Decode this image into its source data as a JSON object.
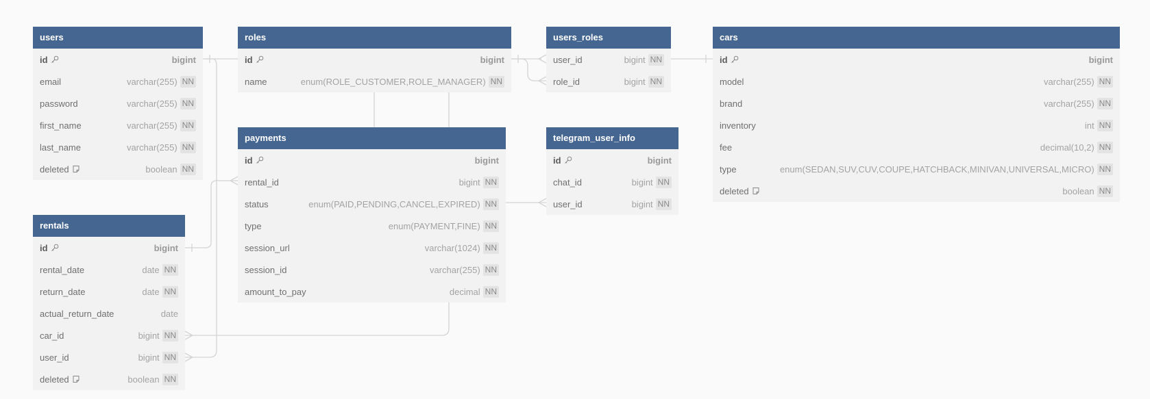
{
  "colors": {
    "header_bg": "#456690",
    "body_bg": "#f2f2f2",
    "canvas_bg": "#fafafa",
    "link": "#d4d4d4"
  },
  "tables": [
    {
      "name": "users",
      "fields": [
        {
          "name": "id",
          "type": "bigint",
          "pk": true,
          "nn": false
        },
        {
          "name": "email",
          "type": "varchar(255)",
          "nn": true
        },
        {
          "name": "password",
          "type": "varchar(255)",
          "nn": true
        },
        {
          "name": "first_name",
          "type": "varchar(255)",
          "nn": true
        },
        {
          "name": "last_name",
          "type": "varchar(255)",
          "nn": true
        },
        {
          "name": "deleted",
          "type": "boolean",
          "nn": true,
          "note": true
        }
      ]
    },
    {
      "name": "roles",
      "fields": [
        {
          "name": "id",
          "type": "bigint",
          "pk": true,
          "nn": false
        },
        {
          "name": "name",
          "type": "enum(ROLE_CUSTOMER,ROLE_MANAGER)",
          "nn": true
        }
      ]
    },
    {
      "name": "users_roles",
      "fields": [
        {
          "name": "user_id",
          "type": "bigint",
          "nn": true
        },
        {
          "name": "role_id",
          "type": "bigint",
          "nn": true
        }
      ]
    },
    {
      "name": "cars",
      "fields": [
        {
          "name": "id",
          "type": "bigint",
          "pk": true,
          "nn": false
        },
        {
          "name": "model",
          "type": "varchar(255)",
          "nn": true
        },
        {
          "name": "brand",
          "type": "varchar(255)",
          "nn": true
        },
        {
          "name": "inventory",
          "type": "int",
          "nn": true
        },
        {
          "name": "fee",
          "type": "decimal(10,2)",
          "nn": true
        },
        {
          "name": "type",
          "type": "enum(SEDAN,SUV,CUV,COUPE,HATCHBACK,MINIVAN,UNIVERSAL,MICRO)",
          "nn": true
        },
        {
          "name": "deleted",
          "type": "boolean",
          "nn": true,
          "note": true
        }
      ]
    },
    {
      "name": "payments",
      "fields": [
        {
          "name": "id",
          "type": "bigint",
          "pk": true,
          "nn": false
        },
        {
          "name": "rental_id",
          "type": "bigint",
          "nn": true
        },
        {
          "name": "status",
          "type": "enum(PAID,PENDING,CANCEL,EXPIRED)",
          "nn": true
        },
        {
          "name": "type",
          "type": "enum(PAYMENT,FINE)",
          "nn": true
        },
        {
          "name": "session_url",
          "type": "varchar(1024)",
          "nn": true
        },
        {
          "name": "session_id",
          "type": "varchar(255)",
          "nn": true
        },
        {
          "name": "amount_to_pay",
          "type": "decimal",
          "nn": true
        }
      ]
    },
    {
      "name": "telegram_user_info",
      "fields": [
        {
          "name": "id",
          "type": "bigint",
          "pk": true,
          "nn": false
        },
        {
          "name": "chat_id",
          "type": "bigint",
          "nn": true
        },
        {
          "name": "user_id",
          "type": "bigint",
          "nn": true
        }
      ]
    },
    {
      "name": "rentals",
      "fields": [
        {
          "name": "id",
          "type": "bigint",
          "pk": true,
          "nn": false
        },
        {
          "name": "rental_date",
          "type": "date",
          "nn": true
        },
        {
          "name": "return_date",
          "type": "date",
          "nn": true
        },
        {
          "name": "actual_return_date",
          "type": "date",
          "nn": false
        },
        {
          "name": "car_id",
          "type": "bigint",
          "nn": true
        },
        {
          "name": "user_id",
          "type": "bigint",
          "nn": true
        },
        {
          "name": "deleted",
          "type": "boolean",
          "nn": true,
          "note": true
        }
      ]
    }
  ],
  "nn_label": "NN",
  "relationships": [
    {
      "from": "users.id",
      "to": "users_roles.user_id",
      "cardinality": "one-to-many"
    },
    {
      "from": "roles.id",
      "to": "users_roles.role_id",
      "cardinality": "one-to-many"
    },
    {
      "from": "users.id",
      "to": "rentals.user_id",
      "cardinality": "one-to-many"
    },
    {
      "from": "rentals.id",
      "to": "payments.rental_id",
      "cardinality": "one-to-many"
    },
    {
      "from": "cars.id",
      "to": "rentals.car_id",
      "cardinality": "one-to-many"
    },
    {
      "from": "users.id",
      "to": "telegram_user_info.user_id",
      "cardinality": "one-to-many"
    }
  ]
}
